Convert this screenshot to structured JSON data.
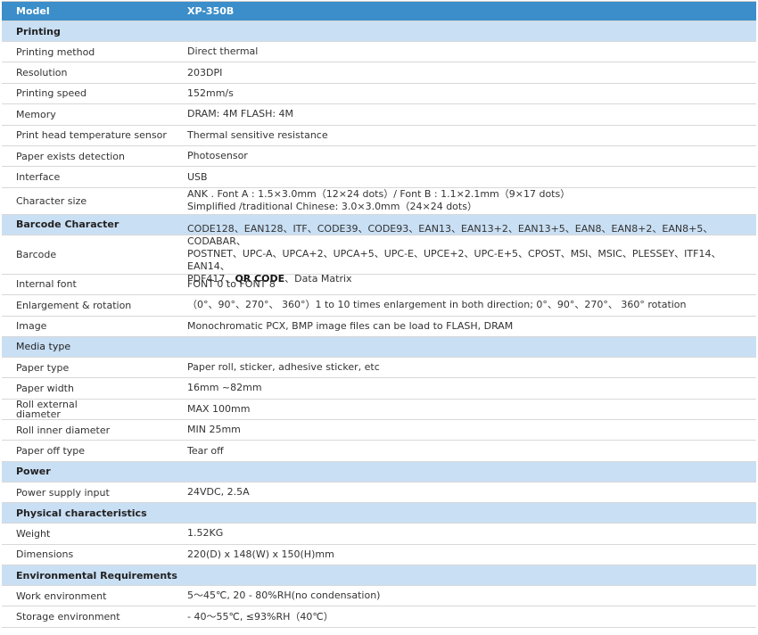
{
  "model": {
    "label": "Model",
    "value": "XP-350B"
  },
  "sections": [
    {
      "title": "Printing",
      "items": [
        {
          "label": "Printing method",
          "value": "Direct thermal"
        },
        {
          "label": "Resolution",
          "value": "203DPI"
        },
        {
          "label": "Printing speed",
          "value": "152mm/s"
        },
        {
          "label": "Memory",
          "value": "DRAM: 4M    FLASH: 4M"
        },
        {
          "label": "Print head temperature sensor",
          "value": "Thermal sensitive resistance"
        },
        {
          "label": "Paper exists detection",
          "value": "Photosensor"
        },
        {
          "label": "Interface",
          "value": "USB"
        },
        {
          "label": "Character size",
          "value_lines": [
            "ANK . Font A : 1.5×3.0mm（12×24 dots）/ Font B : 1.1×2.1mm（9×17 dots）",
            " Simplified /traditional Chinese: 3.0×3.0mm（24×24 dots）"
          ]
        }
      ]
    },
    {
      "title": "Barcode Character",
      "items": [
        {
          "label": "Barcode",
          "value_lines": [
            "CODE128、EAN128、ITF、CODE39、CODE93、EAN13、EAN13+2、EAN13+5、EAN8、EAN8+2、EAN8+5、CODABAR、",
            "POSTNET、UPC-A、UPCA+2、UPCA+5、UPC-E、UPCE+2、UPC-E+5、CPOST、MSI、MSIC、PLESSEY、ITF14、EAN14、"
          ],
          "value_line3_prefix": "PDF417、",
          "value_line3_bold": "QR CODE",
          "value_line3_suffix": "、Data Matrix"
        },
        {
          "label": "Internal font",
          "value": "FONT 0 to FONT 8"
        },
        {
          "label": "Enlargement & rotation",
          "value": "（0°、90°、270°、 360°）1 to 10 times enlargement in both direction; 0°、90°、270°、 360° rotation"
        },
        {
          "label": "Image",
          "value": "Monochromatic PCX, BMP image files can be load to FLASH, DRAM"
        }
      ]
    },
    {
      "title": "Media type",
      "plain": true,
      "items": [
        {
          "label": "Paper type",
          "value": "Paper roll, sticker, adhesive sticker, etc"
        },
        {
          "label": "Paper width",
          "value": "16mm ~82mm"
        },
        {
          "label_lines": [
            "Roll external",
            "diameter"
          ],
          "value": "MAX 100mm"
        },
        {
          "label": "Roll inner diameter",
          "value": "MIN 25mm"
        },
        {
          "label": "Paper off type",
          "value": "Tear off"
        }
      ]
    },
    {
      "title": "Power",
      "items": [
        {
          "label": "Power supply input",
          "value": "24VDC, 2.5A"
        }
      ]
    },
    {
      "title": "Physical characteristics",
      "items": [
        {
          "label": "Weight",
          "value": "1.52KG"
        },
        {
          "label": "Dimensions",
          "value": "220(D) x 148(W) x 150(H)mm"
        }
      ]
    },
    {
      "title": "Environmental Requirements",
      "items": [
        {
          "label": "Work environment",
          "value": "5～45℃, 20 - 80%RH(no condensation)"
        },
        {
          "label": "Storage environment",
          "value": " - 40～55℃, ≤93%RH（40℃）"
        }
      ]
    }
  ]
}
